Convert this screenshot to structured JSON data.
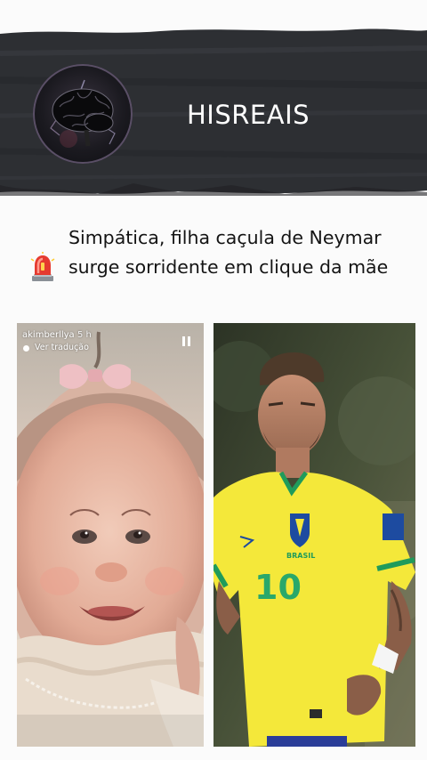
{
  "header": {
    "brand": "HISREAIS",
    "avatar_icon": "brain-icon",
    "banner_color": "#2d2f33"
  },
  "post": {
    "alert_icon": "siren-icon",
    "headline": "Simpática, filha caçula de Neymar surge sorridente em clique da mãe"
  },
  "story": {
    "username": "akimberllya",
    "time": "5 h",
    "translate_label": "Ver tradução",
    "pause_icon": "pause-icon"
  },
  "right_photo": {
    "jersey_number": "10",
    "crest_text": "BRASIL"
  }
}
